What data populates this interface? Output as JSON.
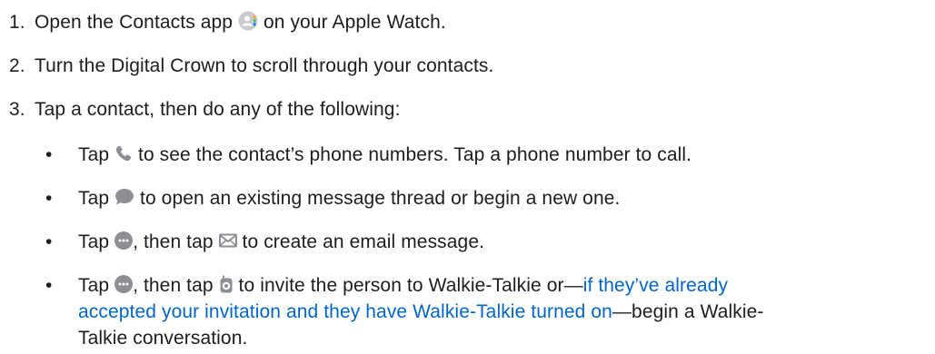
{
  "steps": [
    {
      "number": "1.",
      "before": "Open the Contacts app ",
      "after": " on your Apple Watch."
    },
    {
      "number": "2.",
      "text": "Turn the Digital Crown to scroll through your contacts."
    },
    {
      "number": "3.",
      "text": "Tap a contact, then do any of the following:"
    }
  ],
  "bullets": [
    {
      "marker": "•",
      "before": "Tap ",
      "after": " to see the contact’s phone numbers. Tap a phone number to call."
    },
    {
      "marker": "•",
      "before": "Tap ",
      "after": " to open an existing message thread or begin a new one."
    },
    {
      "marker": "•",
      "before": "Tap ",
      "middle": ", then tap ",
      "after": " to create an email message."
    },
    {
      "marker": "•",
      "before": "Tap ",
      "middle": ", then tap ",
      "after": " to invite the person to Walkie-Talkie or—",
      "link_line1": "if they’ve already",
      "link_line2": "accepted your invitation and they have Walkie-Talkie turned on",
      "after_line2": "—begin a Walkie-",
      "line3": "Talkie conversation."
    }
  ],
  "icons": {
    "contacts_app": "contacts-app-icon",
    "phone": "phone-icon",
    "message": "message-bubble-icon",
    "more": "more-ellipsis-icon",
    "mail": "envelope-icon",
    "walkie": "walkie-talkie-icon"
  },
  "colors": {
    "text": "#1d1d1f",
    "link": "#0066cc",
    "icon_gray": "#8e8e93"
  }
}
